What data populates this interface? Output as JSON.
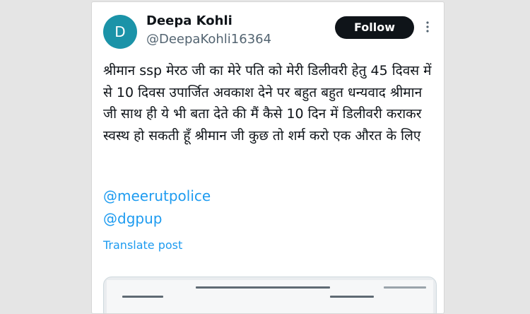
{
  "post": {
    "author": {
      "avatar_letter": "D",
      "name": "Deepa Kohli",
      "handle": "@DeepaKohli16364"
    },
    "follow_label": "Follow",
    "more_icon": "more-vertical-icon",
    "text": "श्रीमान ssp मेरठ जी का मेरे पति को मेरी डिलीवरी हेतु 45 दिवस में से 10 दिवस उपार्जित अवकाश देने पर बहुत बहुत धन्यवाद श्रीमान जी साथ ही ये भी बता देते की मैं कैसे 10 दिन में डिलीवरी कराकर स्वस्थ हो सकती हूँ श्रीमान जी कुछ तो शर्म करो एक औरत के लिए",
    "mentions": [
      "@meerutpolice",
      "@dgpup"
    ],
    "translate_label": "Translate post"
  },
  "colors": {
    "background": "#e5e5e5",
    "card": "#ffffff",
    "avatar": "#1b93a8",
    "text": "#0f1419",
    "secondary": "#536471",
    "link": "#1d9bf0",
    "follow_button": "#0f1419"
  }
}
